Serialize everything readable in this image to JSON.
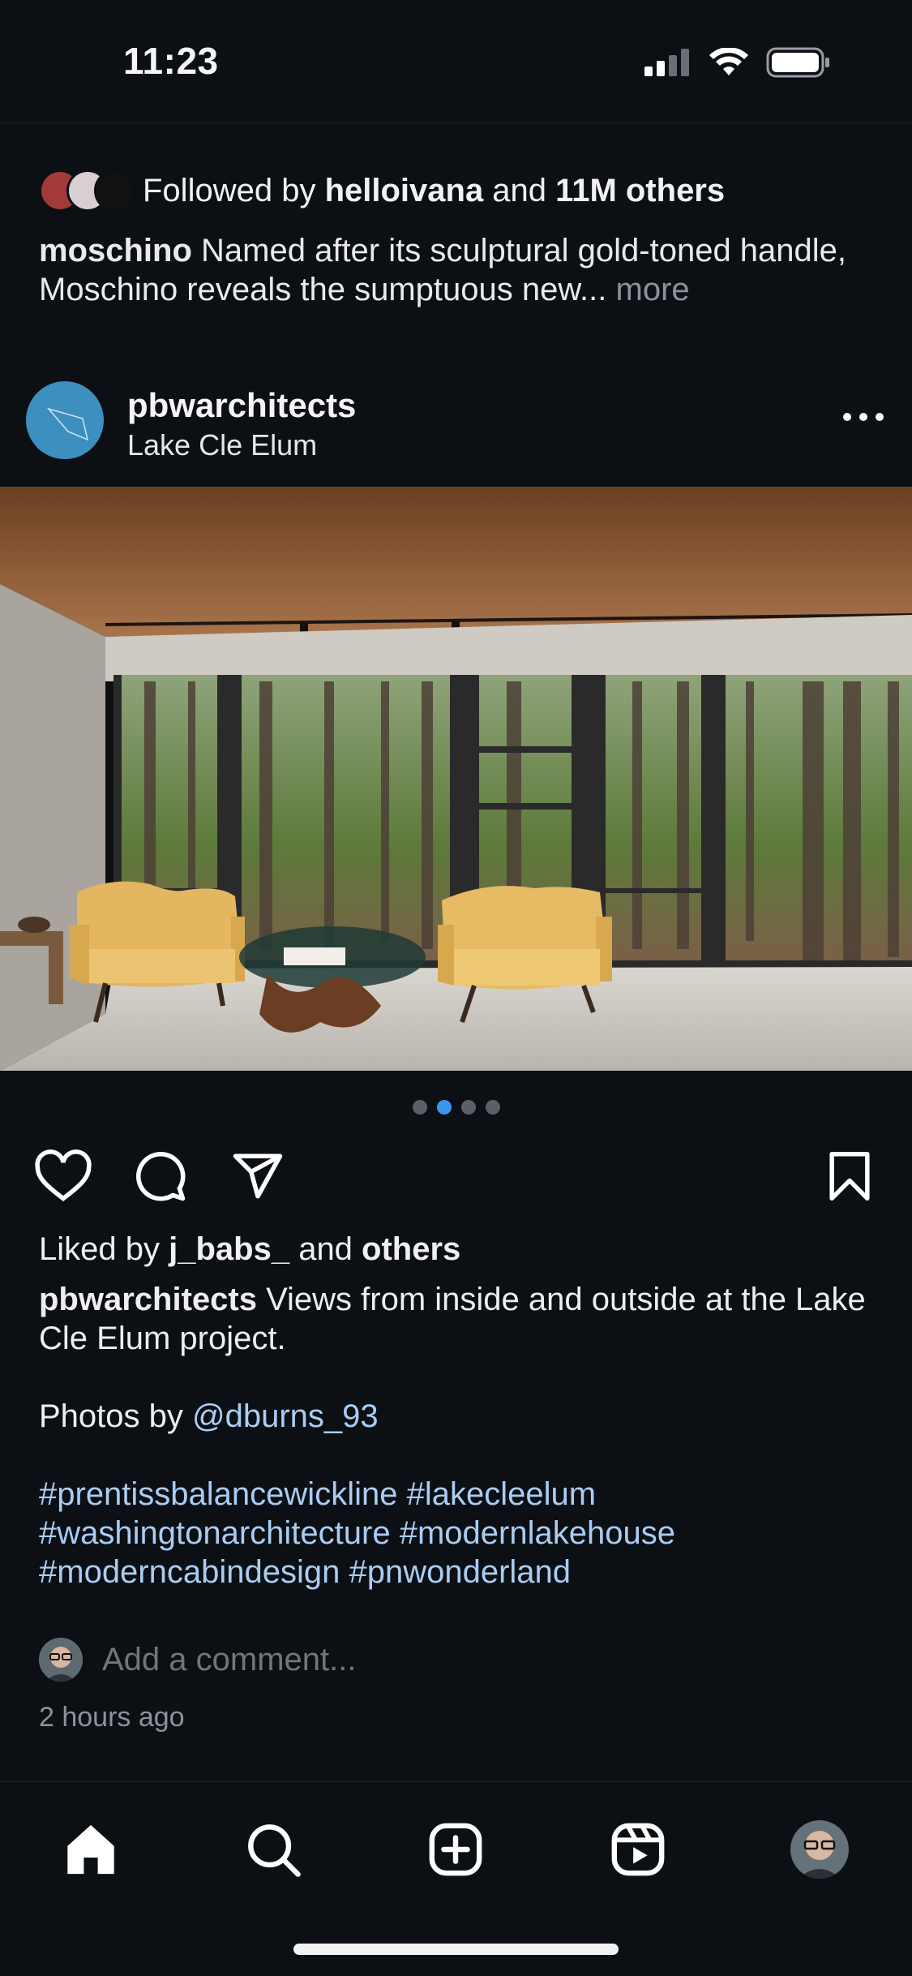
{
  "status_bar": {
    "time": "11:23",
    "icons": [
      "signal-icon",
      "wifi-icon",
      "battery-icon"
    ]
  },
  "previous_post": {
    "followed_prefix": "Followed by ",
    "followed_user": "helloivana",
    "followed_and": " and ",
    "followed_count": "11M others",
    "caption_user": "moschino",
    "caption_text": " Named after its sculptural gold-toned handle, Moschino reveals the sumptuous new...",
    "more_label": "more"
  },
  "post": {
    "username": "pbwarchitects",
    "location": "Lake Cle Elum",
    "carousel": {
      "count": 4,
      "active_index": 1
    },
    "likes_prefix": "Liked by ",
    "likes_user": "j_babs_",
    "likes_and": " and ",
    "likes_others": "others",
    "caption_user": "pbwarchitects",
    "caption_text": " Views from inside and outside at the Lake Cle Elum project.",
    "photos_by_prefix": "Photos by ",
    "photos_by_handle": "@dburns_93",
    "hashtags_line1": "#prentissbalancewickline #lakecleelum",
    "hashtags_line2": "#washingtonarchitecture #modernlakehouse",
    "hashtags_line3": "#moderncabindesign #pnwonderland",
    "comment_placeholder": "Add a comment...",
    "timestamp": "2 hours ago"
  },
  "tab_bar": {
    "tabs": [
      "home-icon",
      "search-icon",
      "create-icon",
      "reels-icon",
      "profile-avatar"
    ],
    "active": "home-icon"
  },
  "colors": {
    "background": "#0c0f14",
    "link": "#a9cdf2",
    "active_dot": "#3a97f0",
    "muted_text": "#8d929a"
  }
}
